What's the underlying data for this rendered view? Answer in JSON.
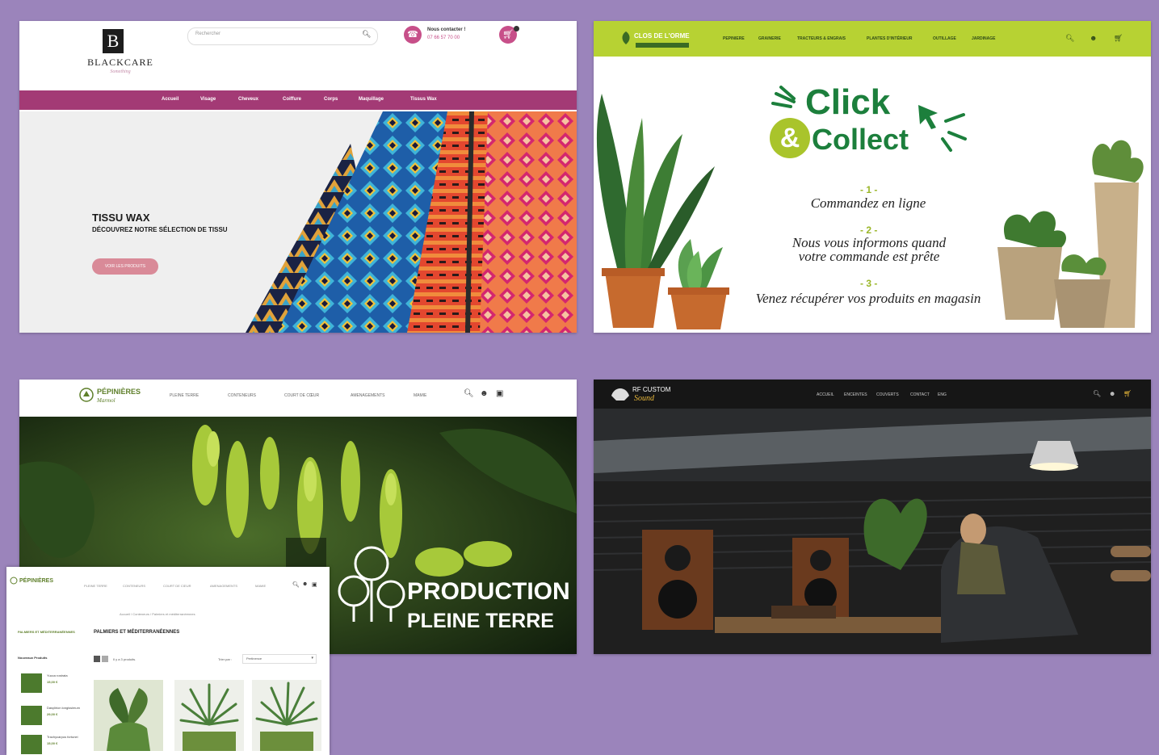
{
  "colors": {
    "background": "#9b84bb",
    "blackcare_nav": "#a33a75",
    "blackcare_accent": "#c74f89",
    "plant_green": "#b7d233",
    "collect_green": "#1c7f3c"
  },
  "blackcare": {
    "logo_letter": "B",
    "logo_name": "BLACKCARE",
    "logo_tagline": "Something",
    "search_placeholder": "Rechercher",
    "search_icon": "search-icon",
    "contact_title": "Nous contacter !",
    "contact_phone": "07 66 57 70 00",
    "nav": [
      "Accueil",
      "Visage",
      "Cheveux",
      "Coiffure",
      "Corps",
      "Maquillage",
      "Tissus Wax"
    ],
    "hero_title": "TISSU WAX",
    "hero_subtitle": "DÉCOUVREZ NOTRE SÉLECTION DE TISSU",
    "hero_button": "VOIR LES PRODUITS"
  },
  "clickcollect": {
    "brand": "CLOS DE L'ORME",
    "menu": [
      "PEPINIERE",
      "GRAINERIE",
      "TRACTEURS & ENGRAIS",
      "PLANTES D'INTÉRIEUR",
      "OUTILLAGE",
      "JARDINAGE"
    ],
    "word_click": "Click",
    "word_amp": "&",
    "word_collect": "Collect",
    "steps": [
      {
        "num": "- 1 -",
        "text": "Commandez en ligne"
      },
      {
        "num": "- 2 -",
        "text": "Nous vous informons quand votre commande est prête"
      },
      {
        "num": "- 3 -",
        "text": "Venez récupérer vos produits en magasin"
      }
    ]
  },
  "pepinieres": {
    "brand": "PÉPINIÈRES",
    "brand_sub": "Marmol",
    "menu": [
      "PLEINE TERRE",
      "CONTENEURS",
      "COURT DE CŒUR",
      "AMENAGEMENTS",
      "MAMIE"
    ],
    "hero_line1": "PRODUCTION",
    "hero_line2": "PLEINE TERRE"
  },
  "rfcustom": {
    "brand": "RF CUSTOM",
    "brand_sub": "Sound",
    "menu": [
      "ACCUEIL",
      "ENCEINTES",
      "COUVERTS",
      "CONTACT",
      "ENG"
    ]
  },
  "category_page": {
    "brand": "PÉPINIÈRES",
    "menu": [
      "PLEINE TERRE",
      "CONTENEURS",
      "COURT DE CŒUR",
      "AMENAGEMENTS",
      "MAMIE"
    ],
    "breadcrumb": "Accueil / Conteneurs / Palmiers et méditerranéennes",
    "sidebar_heading": "PALMIERS ET MÉDITERRANÉENNES",
    "page_heading": "PALMIERS ET MÉDITERRANÉENNES",
    "new_products_heading": "Nouveaux Produits",
    "sidebar_products": [
      {
        "name": "Yucca rostrata",
        "price": "15,00 €"
      },
      {
        "name": "Dasylirion longissimum",
        "price": "29,00 €"
      },
      {
        "name": "Trachycarpus fortunei",
        "price": "15,00 €"
      }
    ],
    "product_count": "Il y a 3 produits.",
    "sort_label": "Trier par :",
    "sort_value": "Pertinence"
  }
}
